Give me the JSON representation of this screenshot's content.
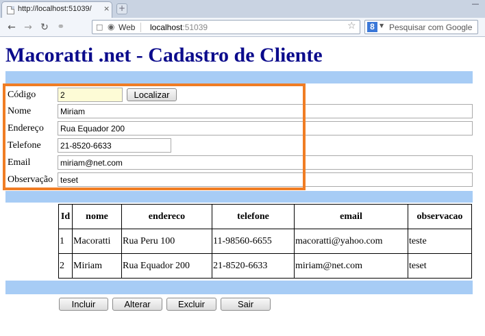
{
  "browser": {
    "tab_title": "http://localhost:51039/",
    "tab_close": "×",
    "new_tab": "+",
    "minimize": "—",
    "icons": {
      "back": "arrow-left-icon",
      "forward": "arrow-right-icon",
      "reload": "reload-icon",
      "key": "key-icon",
      "star": "star-icon"
    },
    "web_label": "Web",
    "url_host": "localhost",
    "url_port": ":51039",
    "search_placeholder": "Pesquisar com Google",
    "search_engine_letter": "8"
  },
  "page": {
    "title": "Macoratti .net - Cadastro de Cliente",
    "band_color": "#a7ccf5",
    "title_color": "#0b0b8c",
    "highlight_color": "#f07d24"
  },
  "form": {
    "codigo": {
      "label": "Código",
      "value": "2"
    },
    "localizar_label": "Localizar",
    "nome": {
      "label": "Nome",
      "value": "Miriam"
    },
    "endereco": {
      "label": "Endereço",
      "value": "Rua Equador 200"
    },
    "telefone": {
      "label": "Telefone",
      "value": "21-8520-6633"
    },
    "email": {
      "label": "Email",
      "value": "miriam@net.com"
    },
    "observacao": {
      "label": "Observação",
      "value": "teset"
    }
  },
  "grid": {
    "headers": [
      "Id",
      "nome",
      "endereco",
      "telefone",
      "email",
      "observacao"
    ],
    "rows": [
      [
        "1",
        "Macoratti",
        "Rua Peru 100",
        "11-98560-6655",
        "macoratti@yahoo.com",
        "teste"
      ],
      [
        "2",
        "Miriam",
        "Rua Equador 200",
        "21-8520-6633",
        "miriam@net.com",
        "teset"
      ]
    ]
  },
  "actions": {
    "incluir": "Incluir",
    "alterar": "Alterar",
    "excluir": "Excluir",
    "sair": "Sair"
  }
}
